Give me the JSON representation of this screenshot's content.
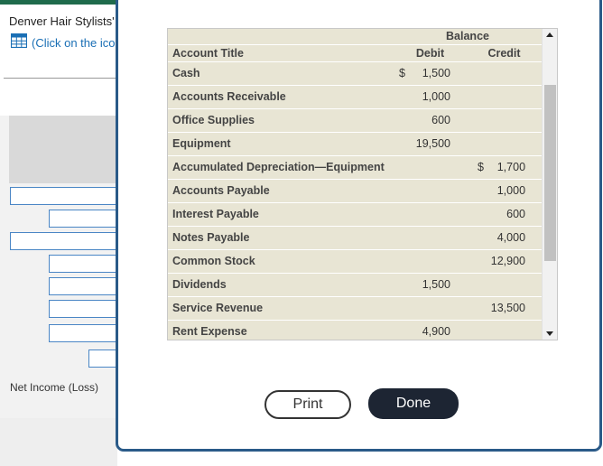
{
  "background": {
    "title": "Denver Hair Stylists'",
    "link_text": "(Click on the ico",
    "net_income_label": "Net Income (Loss)"
  },
  "modal": {
    "table": {
      "group_header": "Balance",
      "col_account_title": "Account Title",
      "col_debit": "Debit",
      "col_credit": "Credit",
      "rows": [
        {
          "title": "Cash",
          "debit_sign": "$",
          "debit": "1,500",
          "credit_sign": "",
          "credit": ""
        },
        {
          "title": "Accounts Receivable",
          "debit_sign": "",
          "debit": "1,000",
          "credit_sign": "",
          "credit": ""
        },
        {
          "title": "Office Supplies",
          "debit_sign": "",
          "debit": "600",
          "credit_sign": "",
          "credit": ""
        },
        {
          "title": "Equipment",
          "debit_sign": "",
          "debit": "19,500",
          "credit_sign": "",
          "credit": ""
        },
        {
          "title": "Accumulated Depreciation—Equipment",
          "debit_sign": "",
          "debit": "",
          "credit_sign": "$",
          "credit": "1,700"
        },
        {
          "title": "Accounts Payable",
          "debit_sign": "",
          "debit": "",
          "credit_sign": "",
          "credit": "1,000"
        },
        {
          "title": "Interest Payable",
          "debit_sign": "",
          "debit": "",
          "credit_sign": "",
          "credit": "600"
        },
        {
          "title": "Notes Payable",
          "debit_sign": "",
          "debit": "",
          "credit_sign": "",
          "credit": "4,000"
        },
        {
          "title": "Common Stock",
          "debit_sign": "",
          "debit": "",
          "credit_sign": "",
          "credit": "12,900"
        },
        {
          "title": "Dividends",
          "debit_sign": "",
          "debit": "1,500",
          "credit_sign": "",
          "credit": ""
        },
        {
          "title": "Service Revenue",
          "debit_sign": "",
          "debit": "",
          "credit_sign": "",
          "credit": "13,500"
        },
        {
          "title": "Rent Expense",
          "debit_sign": "",
          "debit": "4,900",
          "credit_sign": "",
          "credit": ""
        }
      ]
    },
    "print_label": "Print",
    "done_label": "Done"
  },
  "colors": {
    "table_bg": "#e8e5d4",
    "modal_border": "#2a5a88",
    "done_button": "#1d2533",
    "link": "#1a6fb5"
  },
  "icons": {
    "spreadsheet": "grid-icon",
    "scroll_up": "triangle-up",
    "scroll_down": "triangle-down"
  }
}
